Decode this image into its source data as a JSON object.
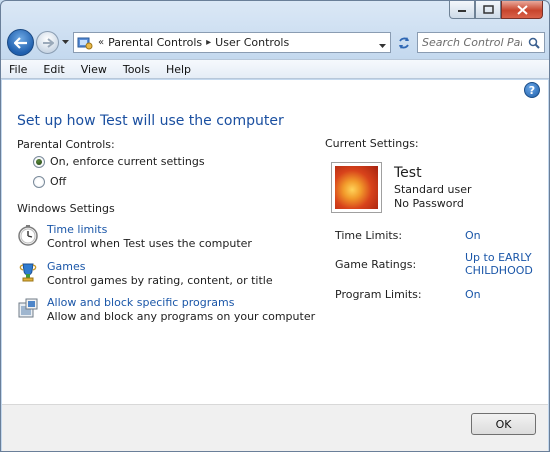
{
  "navigation": {
    "breadcrumb": [
      "Parental Controls",
      "User Controls"
    ],
    "search_placeholder": "Search Control Panel"
  },
  "menu": [
    "File",
    "Edit",
    "View",
    "Tools",
    "Help"
  ],
  "page": {
    "title": "Set up how Test will use the computer",
    "parental_controls_label": "Parental Controls:",
    "radio_on": "On, enforce current settings",
    "radio_off": "Off",
    "selected": "on",
    "windows_settings_label": "Windows Settings",
    "settings": [
      {
        "link": "Time limits",
        "desc": "Control when Test uses the computer",
        "icon": "clock-icon"
      },
      {
        "link": "Games",
        "desc": "Control games by rating, content, or title",
        "icon": "games-trophy-icon"
      },
      {
        "link": "Allow and block specific programs",
        "desc": "Allow and block any programs on your computer",
        "icon": "programs-icon"
      }
    ]
  },
  "current_settings": {
    "label": "Current Settings:",
    "user_name": "Test",
    "user_type": "Standard user",
    "password_status": "No Password",
    "rows": [
      {
        "label": "Time Limits:",
        "value": "On"
      },
      {
        "label": "Game Ratings:",
        "value": "Up to EARLY CHILDHOOD"
      },
      {
        "label": "Program Limits:",
        "value": "On"
      }
    ]
  },
  "footer": {
    "ok_label": "OK"
  },
  "colors": {
    "link": "#1a56a8",
    "title": "#1a4fa0",
    "menubar": "#e5edf6"
  }
}
